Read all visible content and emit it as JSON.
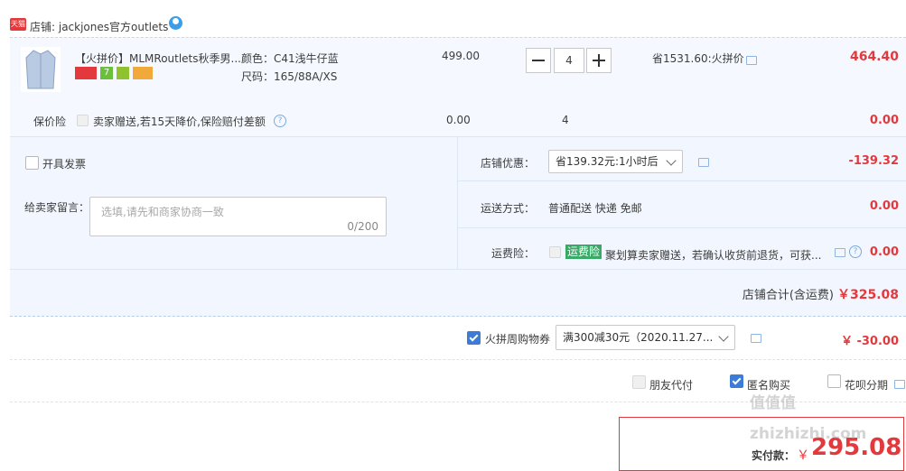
{
  "shop": {
    "badge": "天猫",
    "label": "店铺: jackjones官方outlets"
  },
  "item": {
    "title": "【火拼价】MLMRoutlets秋季男...",
    "color": "颜色：C41浅牛仔蓝",
    "size": "尺码：165/88A/XS",
    "unit_price": "499.00",
    "qty": "4",
    "save_text": "省1531.60:火拼价",
    "subtotal": "464.40"
  },
  "insurance": {
    "label": "保价险",
    "desc": "卖家赠送,若15天降价,保险赔付差额",
    "price": "0.00",
    "qty": "4",
    "total": "0.00"
  },
  "invoice": {
    "label": "开具发票"
  },
  "message": {
    "label": "给卖家留言：",
    "placeholder": "选填,请先和商家协商一致",
    "counter": "0/200"
  },
  "shop_discount": {
    "label": "店铺优惠：",
    "value": "省139.32元:1小时后",
    "amount": "-139.32"
  },
  "shipping": {
    "label": "运送方式：",
    "value": "普通配送 快递 免邮",
    "amount": "0.00"
  },
  "freight_ins": {
    "label": "运费险：",
    "tag": "运费险",
    "desc": "聚划算卖家赠送，若确认收货前退货，可获...",
    "amount": "0.00"
  },
  "shop_total": {
    "label": "店铺合计(含运费)",
    "amount": "￥325.08"
  },
  "coupon": {
    "label": "火拼周购物券",
    "value": "满300减30元（2020.11.27...",
    "amount": "￥ -30.00"
  },
  "options": {
    "friend_pay": "朋友代付",
    "anonymous": "匿名购买",
    "huabei": "花呗分期"
  },
  "payment": {
    "label": "实付款：",
    "currency": "￥",
    "amount": "295.08"
  },
  "watermark": "值值值 zhizhizhi.com",
  "colors": {
    "accent_red": "#e4393c",
    "checkbox_blue": "#3d7cd6",
    "panel_bg": "#f2f7ff"
  }
}
